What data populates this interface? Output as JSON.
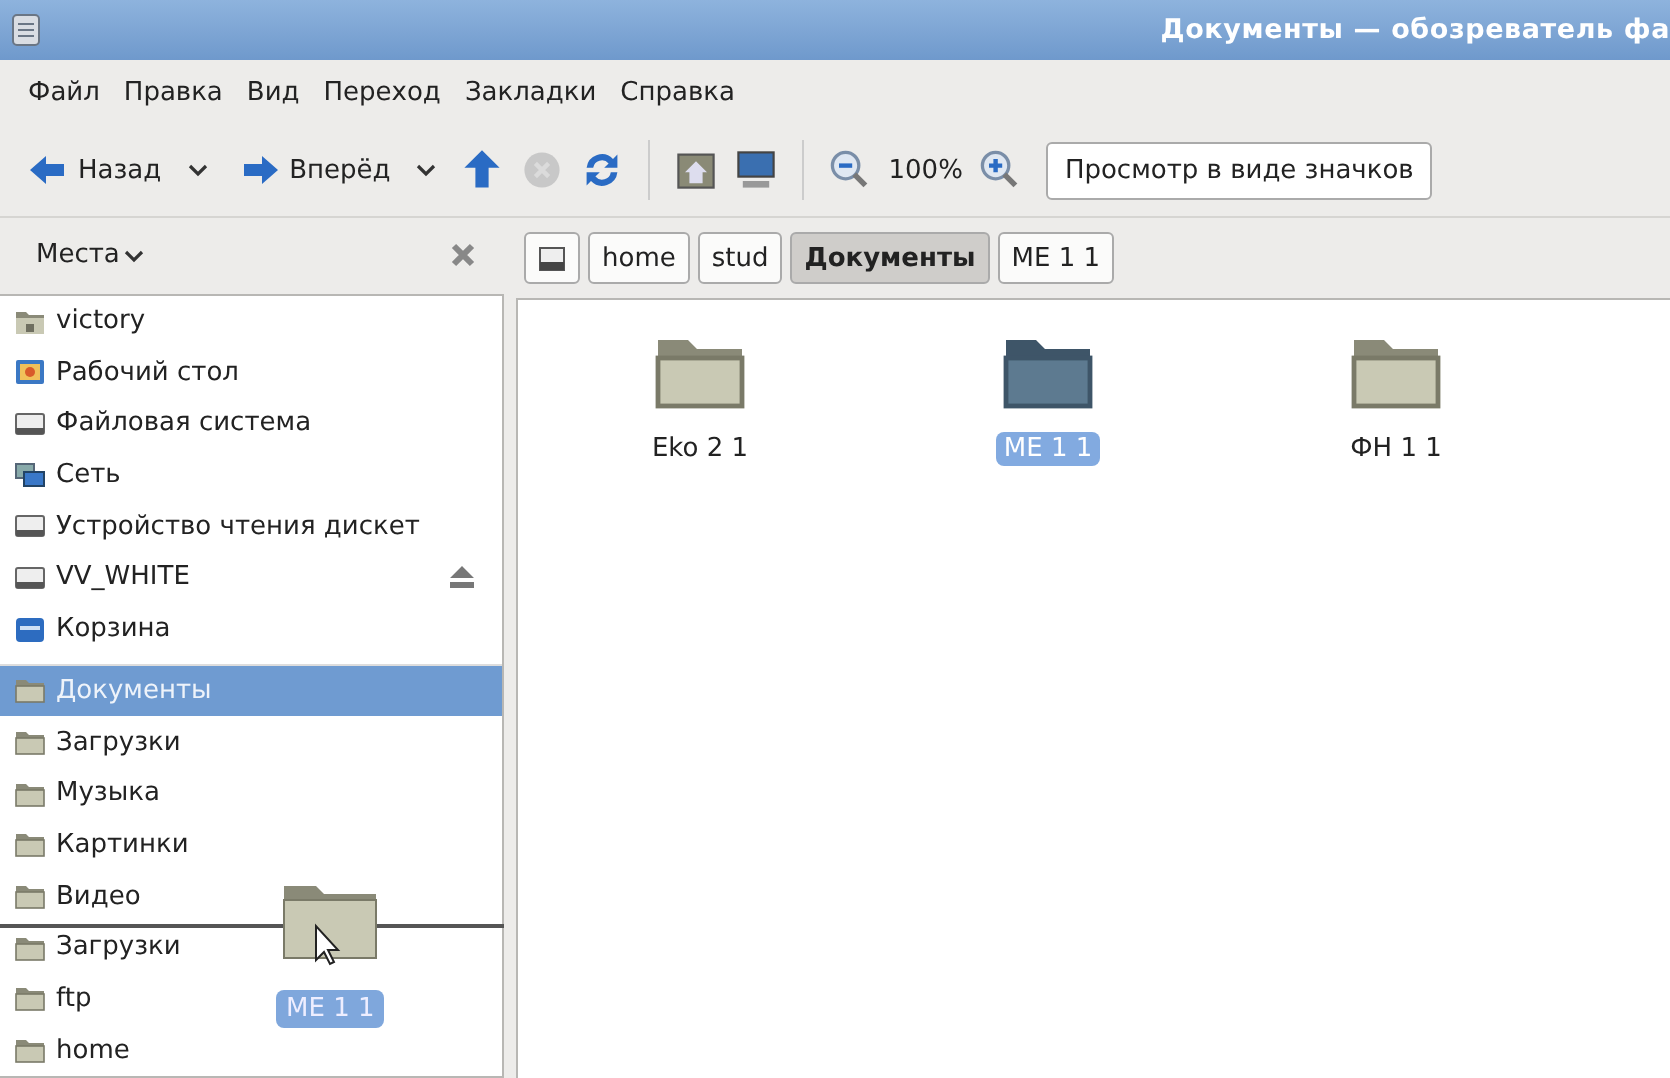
{
  "window": {
    "title": "Документы — обозреватель фа"
  },
  "menu": [
    "Файл",
    "Правка",
    "Вид",
    "Переход",
    "Закладки",
    "Справка"
  ],
  "toolbar": [
    {
      "kind": "back",
      "label": "Назад"
    },
    {
      "kind": "forward",
      "label": "Вперёд"
    },
    {
      "kind": "up"
    },
    {
      "kind": "stop",
      "disabled": true
    },
    {
      "kind": "reload"
    },
    {
      "kind": "separator"
    },
    {
      "kind": "home"
    },
    {
      "kind": "computer"
    },
    {
      "kind": "separator"
    },
    {
      "kind": "zoom-out"
    },
    {
      "kind": "zoom-level",
      "label": "100%"
    },
    {
      "kind": "zoom-in"
    },
    {
      "kind": "view-combo",
      "label": "Просмотр в виде значков"
    }
  ],
  "sidebar": {
    "title": "Места",
    "sections": [
      [
        {
          "label": "victory",
          "kind": "home",
          "selected": false
        },
        {
          "label": "Рабочий стол",
          "kind": "desktop",
          "selected": false
        },
        {
          "label": "Файловая система",
          "kind": "drive",
          "selected": false
        },
        {
          "label": "Сеть",
          "kind": "network",
          "selected": false
        },
        {
          "label": "Устройство чтения дискет",
          "kind": "drive",
          "selected": false
        },
        {
          "label": "VV_WHITE",
          "kind": "drive",
          "selected": false,
          "eject": true
        },
        {
          "label": "Корзина",
          "kind": "trash",
          "selected": false
        }
      ],
      [
        {
          "label": "Документы",
          "kind": "folder",
          "selected": true
        },
        {
          "label": "Загрузки",
          "kind": "folder",
          "selected": false
        },
        {
          "label": "Музыка",
          "kind": "folder",
          "selected": false
        },
        {
          "label": "Картинки",
          "kind": "folder",
          "selected": false
        },
        {
          "label": "Видео",
          "kind": "folder",
          "selected": false
        },
        {
          "label": "Загрузки",
          "kind": "folder",
          "selected": false
        },
        {
          "label": "ftp",
          "kind": "folder",
          "selected": false
        },
        {
          "label": "home",
          "kind": "folder",
          "selected": false
        }
      ]
    ],
    "drag": {
      "label": "ME 1 1"
    }
  },
  "pathbar": [
    {
      "kind": "drive",
      "selected": false
    },
    {
      "label": "home",
      "selected": false
    },
    {
      "label": "stud",
      "selected": false
    },
    {
      "label": "Документы",
      "selected": true
    },
    {
      "label": "ME 1 1",
      "selected": false
    }
  ],
  "files": [
    {
      "name": "Eko 2 1",
      "selected": false
    },
    {
      "name": "ME 1 1",
      "selected": true
    },
    {
      "name": "ФН 1 1",
      "selected": false
    }
  ]
}
